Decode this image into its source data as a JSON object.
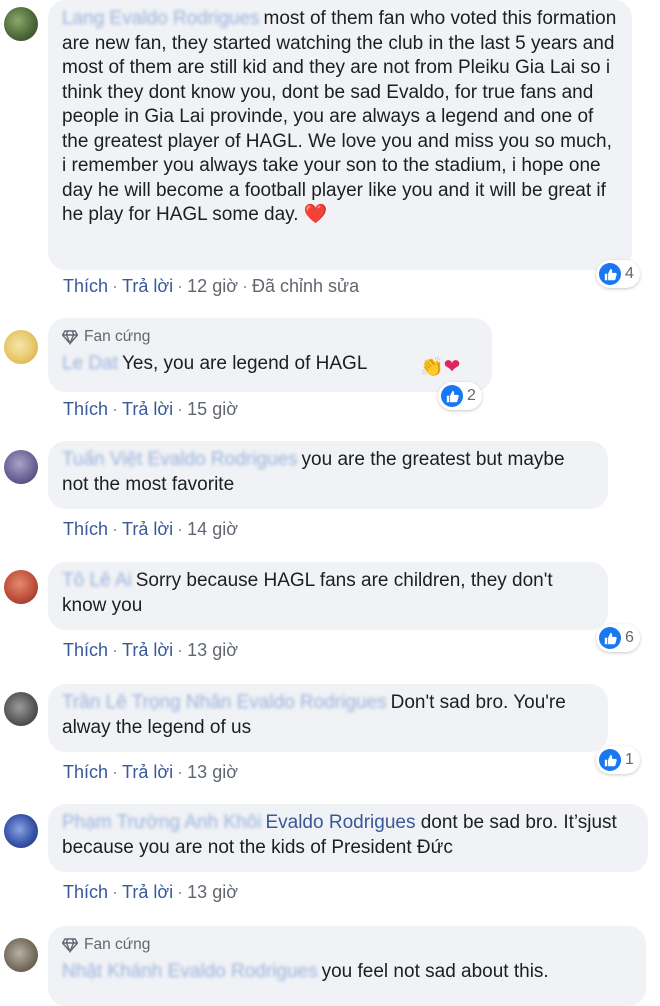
{
  "comments": [
    {
      "author": "Lang Evaldo Rodrigues",
      "text": "most of them fan who voted this formation are new fan, they started watching the club in the last 5 years and most of them are still kid and they are not from Pleiku Gia Lai so i think they dont know you, dont be sad Evaldo, for true fans and people in Gia Lai provinde, you are always a legend and one of the greatest player of HAGL. We love you and miss you so much, i remember you always take your son to the stadium, i hope one day he will become a football player like you and it will be great if he play for HAGL some day.",
      "emoji": "❤️",
      "like": "Thích",
      "reply": "Trả lời",
      "time": "12 giờ",
      "edited": "Đã chỉnh sửa",
      "reactions": "4"
    },
    {
      "badge": "Fan cứng",
      "author": "Le Dat",
      "text": "Yes, you are legend of HAGL",
      "emoji": "👏",
      "heart": "❤",
      "like": "Thích",
      "reply": "Trả lời",
      "time": "15 giờ",
      "reactions": "2"
    },
    {
      "author": "Tuấn Việt Evaldo Rodrigues",
      "text": "you are the greatest but maybe not the most favorite",
      "like": "Thích",
      "reply": "Trả lời",
      "time": "14 giờ"
    },
    {
      "author": "Tô Lê Ai",
      "text": "Sorry because HAGL fans are children, they don't know you",
      "like": "Thích",
      "reply": "Trả lời",
      "time": "13 giờ",
      "reactions": "6"
    },
    {
      "author": "Trần Lê Trọng Nhân Evaldo Rodrigues",
      "text": "Don't sad bro. You're alway the legend of us",
      "like": "Thích",
      "reply": "Trả lời",
      "time": "13 giờ",
      "reactions": "1"
    },
    {
      "author": "Phạm Trường Anh Khôi",
      "mention": "Evaldo Rodrigues",
      "text": "dont be sad bro. It’sjust because you are not the kids of President Đức",
      "like": "Thích",
      "reply": "Trả lời",
      "time": "13 giờ"
    },
    {
      "badge": "Fan cứng",
      "author": "Nhật Khánh Evaldo Rodrigues",
      "text": "you feel not sad about this."
    }
  ],
  "colors": {
    "bubble": "#f0f2f5",
    "link": "#385898",
    "like_blue": "#1877f2",
    "meta": "#606770"
  },
  "icons": {
    "badge": "diamond-icon",
    "like": "thumbs-up-icon"
  }
}
